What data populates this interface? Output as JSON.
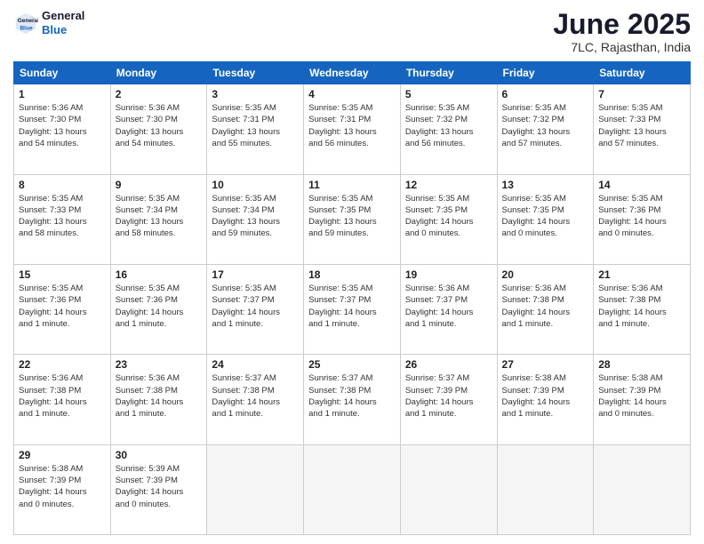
{
  "header": {
    "logo_line1": "General",
    "logo_line2": "Blue",
    "month": "June 2025",
    "location": "7LC, Rajasthan, India"
  },
  "weekdays": [
    "Sunday",
    "Monday",
    "Tuesday",
    "Wednesday",
    "Thursday",
    "Friday",
    "Saturday"
  ],
  "rows": [
    [
      {
        "day": "1",
        "text": "Sunrise: 5:36 AM\nSunset: 7:30 PM\nDaylight: 13 hours\nand 54 minutes."
      },
      {
        "day": "2",
        "text": "Sunrise: 5:36 AM\nSunset: 7:30 PM\nDaylight: 13 hours\nand 54 minutes."
      },
      {
        "day": "3",
        "text": "Sunrise: 5:35 AM\nSunset: 7:31 PM\nDaylight: 13 hours\nand 55 minutes."
      },
      {
        "day": "4",
        "text": "Sunrise: 5:35 AM\nSunset: 7:31 PM\nDaylight: 13 hours\nand 56 minutes."
      },
      {
        "day": "5",
        "text": "Sunrise: 5:35 AM\nSunset: 7:32 PM\nDaylight: 13 hours\nand 56 minutes."
      },
      {
        "day": "6",
        "text": "Sunrise: 5:35 AM\nSunset: 7:32 PM\nDaylight: 13 hours\nand 57 minutes."
      },
      {
        "day": "7",
        "text": "Sunrise: 5:35 AM\nSunset: 7:33 PM\nDaylight: 13 hours\nand 57 minutes."
      }
    ],
    [
      {
        "day": "8",
        "text": "Sunrise: 5:35 AM\nSunset: 7:33 PM\nDaylight: 13 hours\nand 58 minutes."
      },
      {
        "day": "9",
        "text": "Sunrise: 5:35 AM\nSunset: 7:34 PM\nDaylight: 13 hours\nand 58 minutes."
      },
      {
        "day": "10",
        "text": "Sunrise: 5:35 AM\nSunset: 7:34 PM\nDaylight: 13 hours\nand 59 minutes."
      },
      {
        "day": "11",
        "text": "Sunrise: 5:35 AM\nSunset: 7:35 PM\nDaylight: 13 hours\nand 59 minutes."
      },
      {
        "day": "12",
        "text": "Sunrise: 5:35 AM\nSunset: 7:35 PM\nDaylight: 14 hours\nand 0 minutes."
      },
      {
        "day": "13",
        "text": "Sunrise: 5:35 AM\nSunset: 7:35 PM\nDaylight: 14 hours\nand 0 minutes."
      },
      {
        "day": "14",
        "text": "Sunrise: 5:35 AM\nSunset: 7:36 PM\nDaylight: 14 hours\nand 0 minutes."
      }
    ],
    [
      {
        "day": "15",
        "text": "Sunrise: 5:35 AM\nSunset: 7:36 PM\nDaylight: 14 hours\nand 1 minute."
      },
      {
        "day": "16",
        "text": "Sunrise: 5:35 AM\nSunset: 7:36 PM\nDaylight: 14 hours\nand 1 minute."
      },
      {
        "day": "17",
        "text": "Sunrise: 5:35 AM\nSunset: 7:37 PM\nDaylight: 14 hours\nand 1 minute."
      },
      {
        "day": "18",
        "text": "Sunrise: 5:35 AM\nSunset: 7:37 PM\nDaylight: 14 hours\nand 1 minute."
      },
      {
        "day": "19",
        "text": "Sunrise: 5:36 AM\nSunset: 7:37 PM\nDaylight: 14 hours\nand 1 minute."
      },
      {
        "day": "20",
        "text": "Sunrise: 5:36 AM\nSunset: 7:38 PM\nDaylight: 14 hours\nand 1 minute."
      },
      {
        "day": "21",
        "text": "Sunrise: 5:36 AM\nSunset: 7:38 PM\nDaylight: 14 hours\nand 1 minute."
      }
    ],
    [
      {
        "day": "22",
        "text": "Sunrise: 5:36 AM\nSunset: 7:38 PM\nDaylight: 14 hours\nand 1 minute."
      },
      {
        "day": "23",
        "text": "Sunrise: 5:36 AM\nSunset: 7:38 PM\nDaylight: 14 hours\nand 1 minute."
      },
      {
        "day": "24",
        "text": "Sunrise: 5:37 AM\nSunset: 7:38 PM\nDaylight: 14 hours\nand 1 minute."
      },
      {
        "day": "25",
        "text": "Sunrise: 5:37 AM\nSunset: 7:38 PM\nDaylight: 14 hours\nand 1 minute."
      },
      {
        "day": "26",
        "text": "Sunrise: 5:37 AM\nSunset: 7:39 PM\nDaylight: 14 hours\nand 1 minute."
      },
      {
        "day": "27",
        "text": "Sunrise: 5:38 AM\nSunset: 7:39 PM\nDaylight: 14 hours\nand 1 minute."
      },
      {
        "day": "28",
        "text": "Sunrise: 5:38 AM\nSunset: 7:39 PM\nDaylight: 14 hours\nand 0 minutes."
      }
    ],
    [
      {
        "day": "29",
        "text": "Sunrise: 5:38 AM\nSunset: 7:39 PM\nDaylight: 14 hours\nand 0 minutes."
      },
      {
        "day": "30",
        "text": "Sunrise: 5:39 AM\nSunset: 7:39 PM\nDaylight: 14 hours\nand 0 minutes."
      },
      {
        "day": "",
        "text": ""
      },
      {
        "day": "",
        "text": ""
      },
      {
        "day": "",
        "text": ""
      },
      {
        "day": "",
        "text": ""
      },
      {
        "day": "",
        "text": ""
      }
    ]
  ]
}
